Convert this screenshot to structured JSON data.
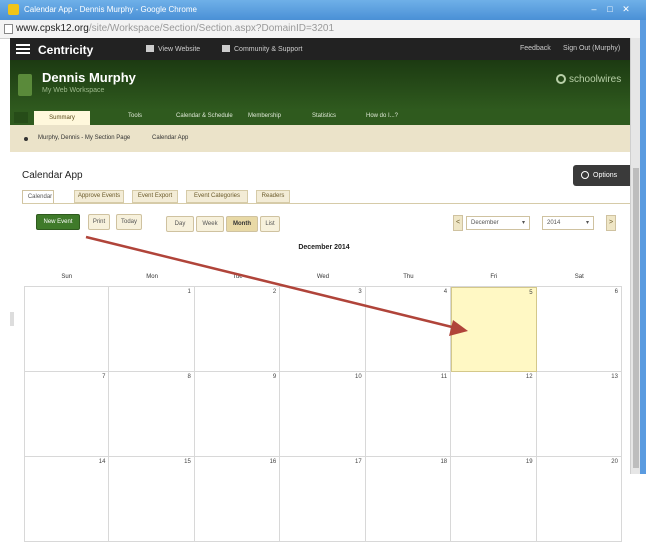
{
  "window": {
    "title": "Calendar App - Dennis Murphy - Google Chrome",
    "controls": [
      "–",
      "□",
      "✕"
    ]
  },
  "address": {
    "domain": "www.cpsk12.org",
    "path": "/site/Workspace/Section/Section.aspx?DomainID=3201"
  },
  "app": {
    "brand": "Centricity",
    "nav": [
      "View Website",
      "Community & Support"
    ],
    "utility": [
      "Feedback",
      "Sign Out (Murphy)"
    ]
  },
  "banner": {
    "name": "Dennis Murphy",
    "subtitle": "My Web Workspace",
    "logo": "schoolwires"
  },
  "tabs": [
    "Summary",
    "Tools",
    "Calendar & Schedule",
    "Membership",
    "Statistics",
    "How do I...?"
  ],
  "breadcrumb": [
    "Murphy, Dennis - My Section Page",
    "Calendar App"
  ],
  "calendar_app": {
    "title": "Calendar App",
    "options_label": "Options",
    "subtabs": [
      "Calendar",
      "Approve Events",
      "Event Export",
      "Event Categories",
      "Readers"
    ],
    "buttons": {
      "new_event": "New Event",
      "print": "Print",
      "today": "Today",
      "views": [
        "Day",
        "Week",
        "Month",
        "List"
      ],
      "active_view": "Month"
    },
    "nav": {
      "prev": "<",
      "next": ">"
    },
    "month_select": "December",
    "year_select": "2014",
    "month_title": "December 2014",
    "weekdays": [
      "Sun",
      "Mon",
      "Tue",
      "Wed",
      "Thu",
      "Fri",
      "Sat"
    ],
    "weeks": [
      [
        "",
        "1",
        "2",
        "3",
        "4",
        "5",
        "6"
      ],
      [
        "7",
        "8",
        "9",
        "10",
        "11",
        "12",
        "13"
      ],
      [
        "14",
        "15",
        "16",
        "17",
        "18",
        "19",
        "20"
      ]
    ],
    "highlighted_day": "5"
  },
  "colors": {
    "annotation_arrow": "#b0443a",
    "highlight": "#fff8c4",
    "accent_green": "#3f7a2a"
  }
}
